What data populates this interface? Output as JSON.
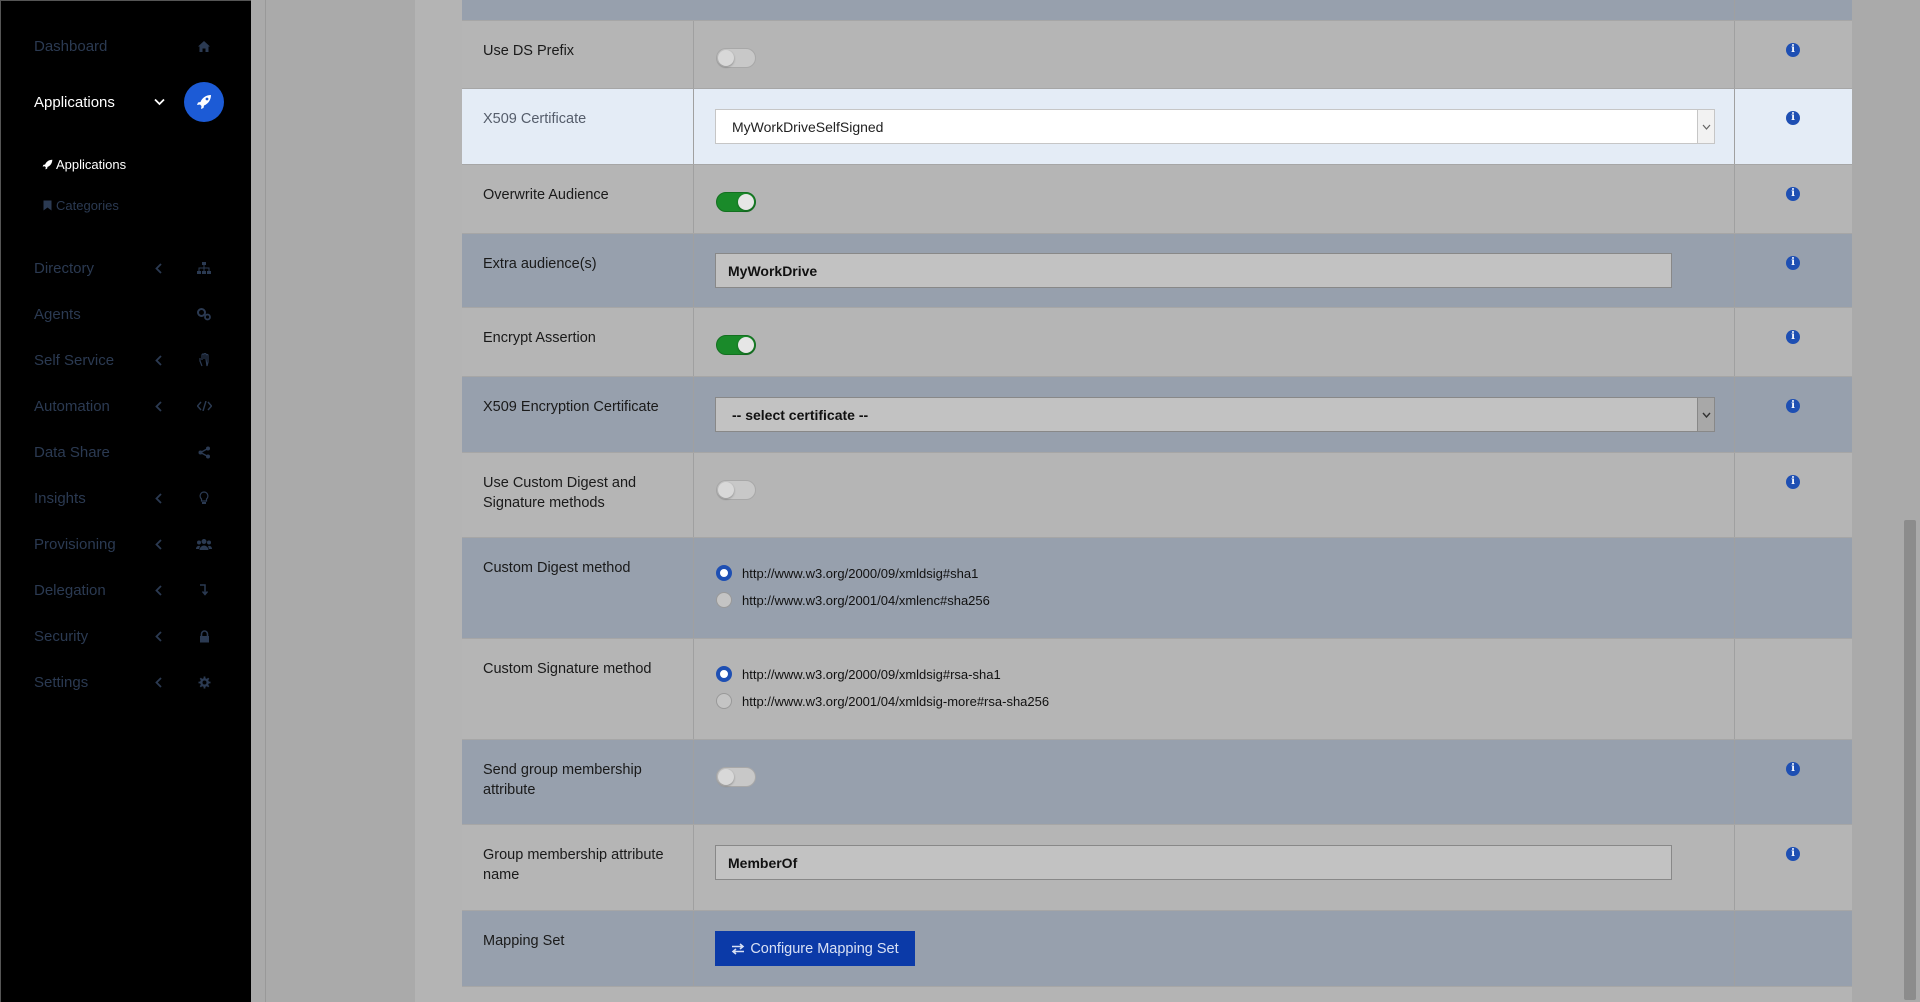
{
  "sidebar": {
    "items": [
      {
        "label": "Dashboard",
        "icon": "home-icon",
        "chevron": false,
        "active": false
      },
      {
        "label": "Applications",
        "icon": "rocket-icon",
        "chevron": true,
        "active": true
      },
      {
        "label": "Directory",
        "icon": "sitemap-icon",
        "chevron": true,
        "active": false
      },
      {
        "label": "Agents",
        "icon": "cogs-icon",
        "chevron": false,
        "active": false
      },
      {
        "label": "Self Service",
        "icon": "hand-icon",
        "chevron": true,
        "active": false
      },
      {
        "label": "Automation",
        "icon": "code-icon",
        "chevron": true,
        "active": false
      },
      {
        "label": "Data Share",
        "icon": "share-icon",
        "chevron": false,
        "active": false
      },
      {
        "label": "Insights",
        "icon": "lightbulb-icon",
        "chevron": true,
        "active": false
      },
      {
        "label": "Provisioning",
        "icon": "users-icon",
        "chevron": true,
        "active": false
      },
      {
        "label": "Delegation",
        "icon": "level-down-icon",
        "chevron": true,
        "active": false
      },
      {
        "label": "Security",
        "icon": "lock-icon",
        "chevron": true,
        "active": false
      },
      {
        "label": "Settings",
        "icon": "gear-icon",
        "chevron": true,
        "active": false
      }
    ],
    "subitems": [
      {
        "label": "Applications",
        "icon": "rocket-icon",
        "active": true
      },
      {
        "label": "Categories",
        "icon": "bookmark-icon",
        "active": false
      }
    ]
  },
  "form": {
    "use_ds_prefix": {
      "label": "Use DS Prefix",
      "enabled": false
    },
    "x509_certificate": {
      "label": "X509 Certificate",
      "value": "MyWorkDriveSelfSigned"
    },
    "overwrite_audience": {
      "label": "Overwrite Audience",
      "enabled": true
    },
    "extra_audiences": {
      "label": "Extra audience(s)",
      "value": "MyWorkDrive"
    },
    "encrypt_assertion": {
      "label": "Encrypt Assertion",
      "enabled": true
    },
    "x509_encryption_certificate": {
      "label": "X509 Encryption Certificate",
      "value": "-- select certificate --"
    },
    "use_custom_digest": {
      "label": "Use Custom Digest and Signature methods",
      "enabled": false
    },
    "custom_digest_method": {
      "label": "Custom Digest method",
      "options": [
        "http://www.w3.org/2000/09/xmldsig#sha1",
        "http://www.w3.org/2001/04/xmlenc#sha256"
      ],
      "selected": 0
    },
    "custom_signature_method": {
      "label": "Custom Signature method",
      "options": [
        "http://www.w3.org/2000/09/xmldsig#rsa-sha1",
        "http://www.w3.org/2001/04/xmldsig-more#rsa-sha256"
      ],
      "selected": 0
    },
    "send_group_membership": {
      "label": "Send group membership attribute",
      "enabled": false
    },
    "group_membership_name": {
      "label": "Group membership attribute name",
      "value": "MemberOf"
    },
    "mapping_set": {
      "label": "Mapping Set",
      "button_label": "Configure Mapping Set"
    }
  },
  "colors": {
    "accent": "#1c5bd6",
    "toggle_on": "#1a8a2a",
    "button": "#0b3aa8",
    "info": "#1e4fb3"
  }
}
